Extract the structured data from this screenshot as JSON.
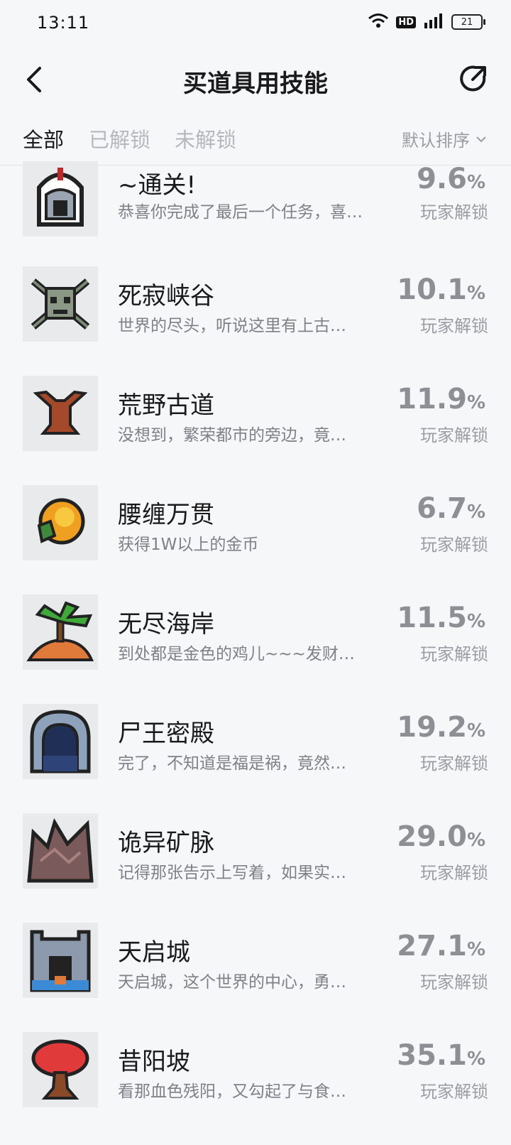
{
  "status": {
    "time": "13:11",
    "hd": "HD",
    "battery": "21"
  },
  "header": {
    "title": "买道具用技能"
  },
  "tabs": [
    {
      "label": "全部",
      "active": true
    },
    {
      "label": "已解锁",
      "active": false
    },
    {
      "label": "未解锁",
      "active": false
    }
  ],
  "sort": {
    "label": "默认排序"
  },
  "percent_sign": "%",
  "items": [
    {
      "name": "~通关!",
      "desc": "恭喜你完成了最后一个任务，喜…",
      "pct": "9.6",
      "label": "玩家解锁",
      "icon": "helmet-icon"
    },
    {
      "name": "死寂峡谷",
      "desc": "世界的尽头，听说这里有上古…",
      "pct": "10.1",
      "label": "玩家解锁",
      "icon": "skull-icon"
    },
    {
      "name": "荒野古道",
      "desc": "没想到，繁荣都市的旁边，竟…",
      "pct": "11.9",
      "label": "玩家解锁",
      "icon": "tree-stump-icon"
    },
    {
      "name": "腰缠万贯",
      "desc": "获得1W以上的金币",
      "pct": "6.7",
      "label": "玩家解锁",
      "icon": "gold-coin-icon"
    },
    {
      "name": "无尽海岸",
      "desc": "到处都是金色的鸡儿~~~发财…",
      "pct": "11.5",
      "label": "玩家解锁",
      "icon": "palm-island-icon"
    },
    {
      "name": "尸王密殿",
      "desc": "完了，不知道是福是祸，竟然…",
      "pct": "19.2",
      "label": "玩家解锁",
      "icon": "crypt-door-icon"
    },
    {
      "name": "诡异矿脉",
      "desc": "记得那张告示上写着，如果实…",
      "pct": "29.0",
      "label": "玩家解锁",
      "icon": "rock-icon"
    },
    {
      "name": "天启城",
      "desc": "天启城，这个世界的中心，勇…",
      "pct": "27.1",
      "label": "玩家解锁",
      "icon": "castle-gate-icon"
    },
    {
      "name": "昔阳坡",
      "desc": "看那血色残阳，又勾起了与食…",
      "pct": "35.1",
      "label": "玩家解锁",
      "icon": "red-tree-icon"
    }
  ]
}
